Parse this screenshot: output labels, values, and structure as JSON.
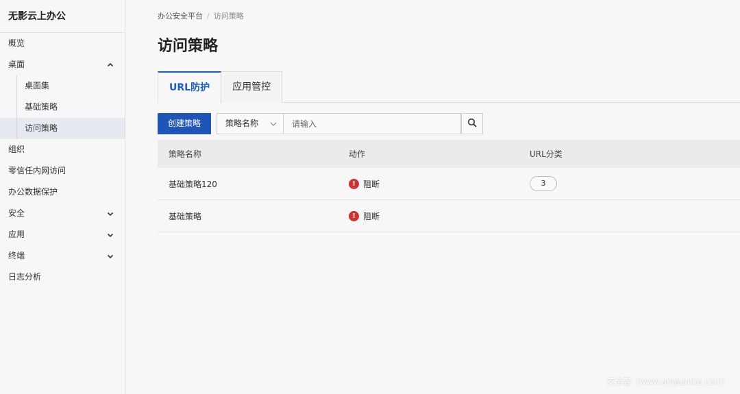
{
  "sidebar": {
    "brand": "无影云上办公",
    "items": [
      {
        "label": "概览"
      },
      {
        "label": "桌面"
      },
      {
        "label": "桌面集"
      },
      {
        "label": "基础策略"
      },
      {
        "label": "访问策略"
      },
      {
        "label": "组织"
      },
      {
        "label": "零信任内网访问"
      },
      {
        "label": "办公数据保护"
      },
      {
        "label": "安全"
      },
      {
        "label": "应用"
      },
      {
        "label": "终端"
      },
      {
        "label": "日志分析"
      }
    ]
  },
  "breadcrumb": {
    "root": "办公安全平台",
    "separator": "/",
    "current": "访问策略"
  },
  "page": {
    "title": "访问策略"
  },
  "tabs": [
    {
      "label": "URL防护"
    },
    {
      "label": "应用管控"
    }
  ],
  "toolbar": {
    "create_label": "创建策略",
    "filter_selected": "策略名称",
    "search_placeholder": "请输入"
  },
  "table": {
    "headers": [
      "策略名称",
      "动作",
      "URL分类"
    ],
    "rows": [
      {
        "name": "基础策略120",
        "action": "阻断",
        "url_count": "3"
      },
      {
        "name": "基础策略",
        "action": "阻断",
        "url_count": ""
      }
    ]
  },
  "watermark": "安全客（www.anquanke.com）",
  "colors": {
    "accent": "#1e56b7",
    "danger": "#d32f2f",
    "active_nav": "#e6eaf0"
  },
  "icons": {
    "collapse": "chevron-up-icon",
    "expand": "chevron-down-icon",
    "search": "search-icon",
    "action": "exclamation-circle-icon"
  }
}
